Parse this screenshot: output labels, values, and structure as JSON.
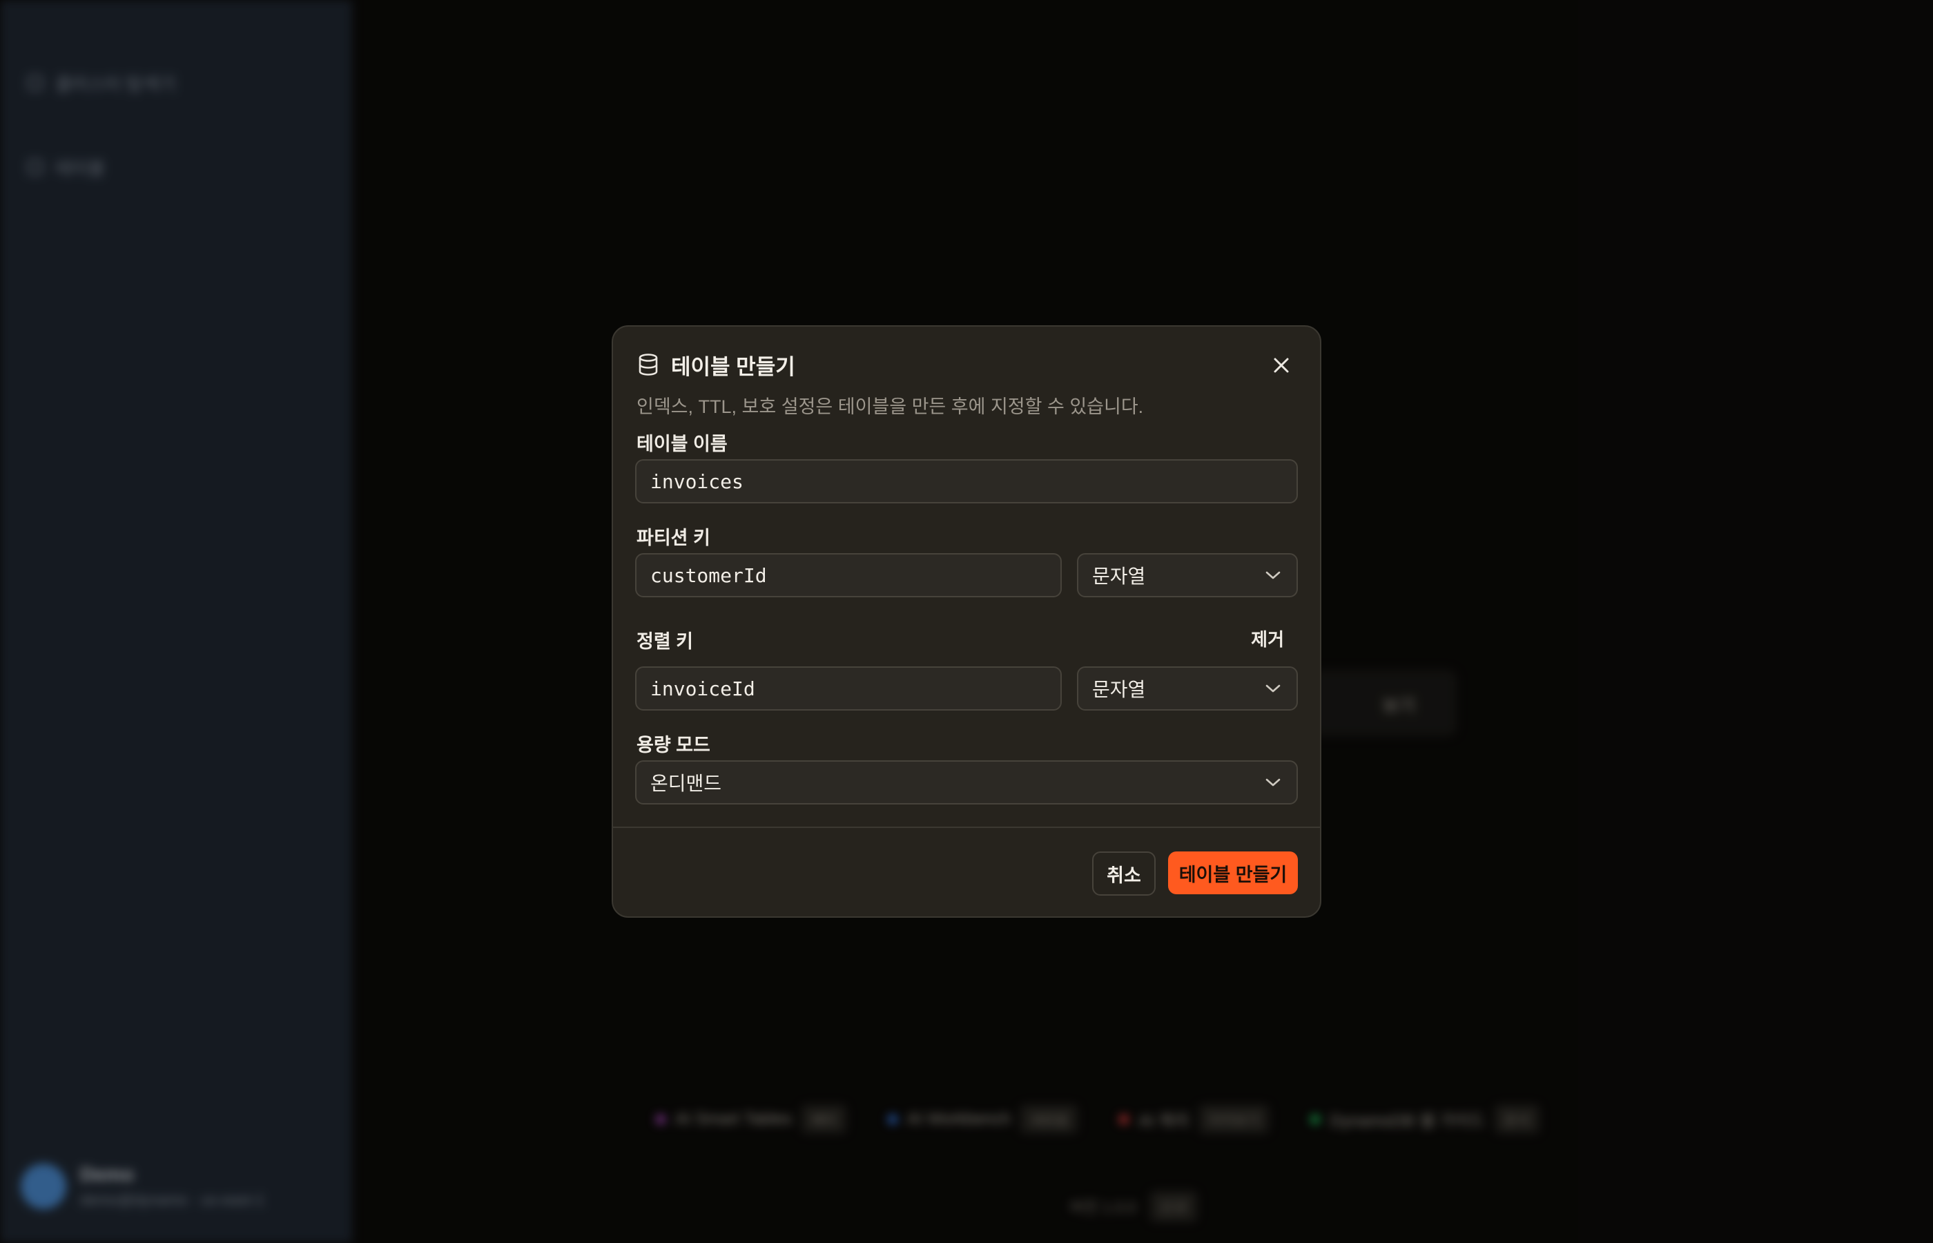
{
  "background": {
    "sidebar_items": [
      "클러스터 탐색기",
      "테이블"
    ],
    "user": {
      "name": "Demo",
      "email": "demo@dynamo · us-east-1"
    },
    "card_action": "보기",
    "chips": [
      {
        "label": "AI Smart Tables",
        "tag": "베타",
        "color": "#b54ec9"
      },
      {
        "label": "AI Workbench",
        "tag": "새로움",
        "color": "#3b82f6"
      },
      {
        "label": "AI 쿼리",
        "tag": "미리보기",
        "color": "#ef4444"
      },
      {
        "label": "DynamoDB 쉘 가이드",
        "tag": "문서",
        "color": "#22c55e"
      }
    ],
    "footer_text": "버전 1.0.0",
    "footer_tag": "신규"
  },
  "modal": {
    "title": "테이블 만들기",
    "subtitle": "인덱스, TTL, 보호 설정은 테이블을 만든 후에 지정할 수 있습니다.",
    "table_name": {
      "label": "테이블 이름",
      "value": "invoices"
    },
    "partition_key": {
      "label": "파티션 키",
      "value": "customerId",
      "type": "문자열"
    },
    "sort_key": {
      "label": "정렬 키",
      "value": "invoiceId",
      "type": "문자열",
      "remove_label": "제거"
    },
    "capacity_mode": {
      "label": "용량 모드",
      "value": "온디맨드"
    },
    "cancel_label": "취소",
    "create_label": "테이블 만들기"
  },
  "colors": {
    "accent": "#ff5a1f",
    "modal_bg": "#26231d",
    "sidebar_bg": "#212934"
  }
}
